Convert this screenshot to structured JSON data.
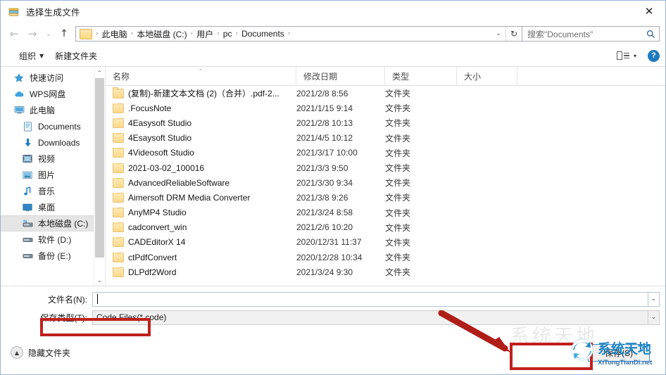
{
  "window": {
    "title": "选择生成文件",
    "icon": "folder-stack-icon",
    "close_label": "✕"
  },
  "nav": {
    "back": "←",
    "forward": "→",
    "recent": "⌄",
    "up": "↑",
    "refresh": "↻",
    "dropdown": "⌄",
    "breadcrumbs": [
      "此电脑",
      "本地磁盘 (C:)",
      "用户",
      "pc",
      "Documents"
    ],
    "separator": "›"
  },
  "search": {
    "placeholder": "搜索\"Documents\"",
    "icon": "magnifier-icon"
  },
  "toolbar": {
    "organize_label": "组织",
    "new_folder_label": "新建文件夹",
    "view_icon": "list-view-icon",
    "view_caret": "▾",
    "help_label": "?"
  },
  "sidebar": {
    "items": [
      {
        "label": "快速访问",
        "icon": "star-icon",
        "indent": false,
        "selected": false
      },
      {
        "label": "WPS网盘",
        "icon": "cloud-icon",
        "indent": false,
        "selected": false
      },
      {
        "label": "此电脑",
        "icon": "computer-icon",
        "indent": false,
        "selected": false
      },
      {
        "label": "Documents",
        "icon": "documents-icon",
        "indent": true,
        "selected": false
      },
      {
        "label": "Downloads",
        "icon": "download-arrow-icon",
        "indent": true,
        "selected": false
      },
      {
        "label": "视频",
        "icon": "video-icon",
        "indent": true,
        "selected": false
      },
      {
        "label": "图片",
        "icon": "picture-icon",
        "indent": true,
        "selected": false
      },
      {
        "label": "音乐",
        "icon": "music-note-icon",
        "indent": true,
        "selected": false
      },
      {
        "label": "桌面",
        "icon": "desktop-icon",
        "indent": true,
        "selected": false
      },
      {
        "label": "本地磁盘 (C:)",
        "icon": "system-drive-icon",
        "indent": true,
        "selected": true
      },
      {
        "label": "软件 (D:)",
        "icon": "drive-icon",
        "indent": true,
        "selected": false
      },
      {
        "label": "备份 (E:)",
        "icon": "drive-icon",
        "indent": true,
        "selected": false
      }
    ],
    "scroll_up": "⌃",
    "scroll_down": "⌄"
  },
  "filelist": {
    "columns": [
      "名称",
      "修改日期",
      "类型",
      "大小"
    ],
    "sort_indicator": "⌃",
    "rows": [
      {
        "name": "(复制)-新建文本文档 (2)（合并）.pdf-2...",
        "date": "2021/2/8 8:56",
        "type": "文件夹",
        "size": ""
      },
      {
        "name": ".FocusNote",
        "date": "2021/1/15 9:14",
        "type": "文件夹",
        "size": ""
      },
      {
        "name": "4Easysoft Studio",
        "date": "2021/2/8 10:13",
        "type": "文件夹",
        "size": ""
      },
      {
        "name": "4Esaysoft Studio",
        "date": "2021/4/5 10:12",
        "type": "文件夹",
        "size": ""
      },
      {
        "name": "4Videosoft Studio",
        "date": "2021/3/17 10:00",
        "type": "文件夹",
        "size": ""
      },
      {
        "name": "2021-03-02_100016",
        "date": "2021/3/3 9:50",
        "type": "文件夹",
        "size": ""
      },
      {
        "name": "AdvancedReliableSoftware",
        "date": "2021/3/30 9:34",
        "type": "文件夹",
        "size": ""
      },
      {
        "name": "Aimersoft DRM Media Converter",
        "date": "2021/3/8 9:26",
        "type": "文件夹",
        "size": ""
      },
      {
        "name": "AnyMP4 Studio",
        "date": "2021/3/24 8:58",
        "type": "文件夹",
        "size": ""
      },
      {
        "name": "cadconvert_win",
        "date": "2021/2/6 10:20",
        "type": "文件夹",
        "size": ""
      },
      {
        "name": "CADEditorX 14",
        "date": "2020/12/31 11:37",
        "type": "文件夹",
        "size": ""
      },
      {
        "name": "ctPdfConvert",
        "date": "2020/12/28 10:34",
        "type": "文件夹",
        "size": ""
      },
      {
        "name": "DLPdf2Word",
        "date": "2021/3/24 9:30",
        "type": "文件夹",
        "size": ""
      }
    ]
  },
  "form": {
    "filename_label": "文件名(N):",
    "filename_value": "",
    "filetype_label": "保存类型(T):",
    "filetype_value": "Code Files(*.code)",
    "combo_arrow": "⌄"
  },
  "footer": {
    "hide_folders_label": "隐藏文件夹",
    "collapse_icon": "▲",
    "save_label": "保存(S)"
  },
  "watermark": {
    "brand_cn": "系统天地",
    "brand_url": "XiTongTianDi.net",
    "ghost_text": "系统天地"
  },
  "annotations": {
    "filename_highlight": "red-rectangle",
    "save_highlight": "red-rectangle",
    "pointer": "red-arrow"
  }
}
